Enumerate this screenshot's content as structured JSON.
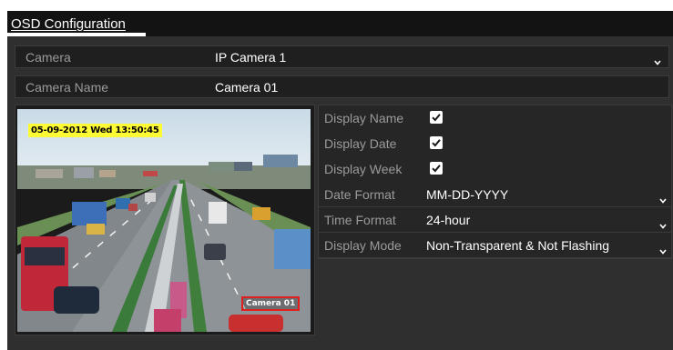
{
  "title": "OSD Configuration",
  "camera_row": {
    "label": "Camera",
    "value": "IP Camera 1"
  },
  "camera_name_row": {
    "label": "Camera Name",
    "value": "Camera 01"
  },
  "preview": {
    "osd_datetime": "05-09-2012 Wed 13:50:45",
    "osd_camera_name": "Camera 01"
  },
  "options": {
    "display_name": {
      "label": "Display Name",
      "checked": true
    },
    "display_date": {
      "label": "Display Date",
      "checked": true
    },
    "display_week": {
      "label": "Display Week",
      "checked": true
    },
    "date_format": {
      "label": "Date Format",
      "value": "MM-DD-YYYY"
    },
    "time_format": {
      "label": "Time Format",
      "value": "24-hour"
    },
    "display_mode": {
      "label": "Display Mode",
      "value": "Non-Transparent & Not Flashing"
    }
  },
  "icons": {
    "dropdown": "chevron-down-icon",
    "checkbox": "checkmark-icon"
  },
  "colors": {
    "panel_bg": "#2f2f2f",
    "title_bar": "#131313",
    "osd_date_highlight": "#fffb34",
    "osd_name_border": "#e01e1e"
  }
}
